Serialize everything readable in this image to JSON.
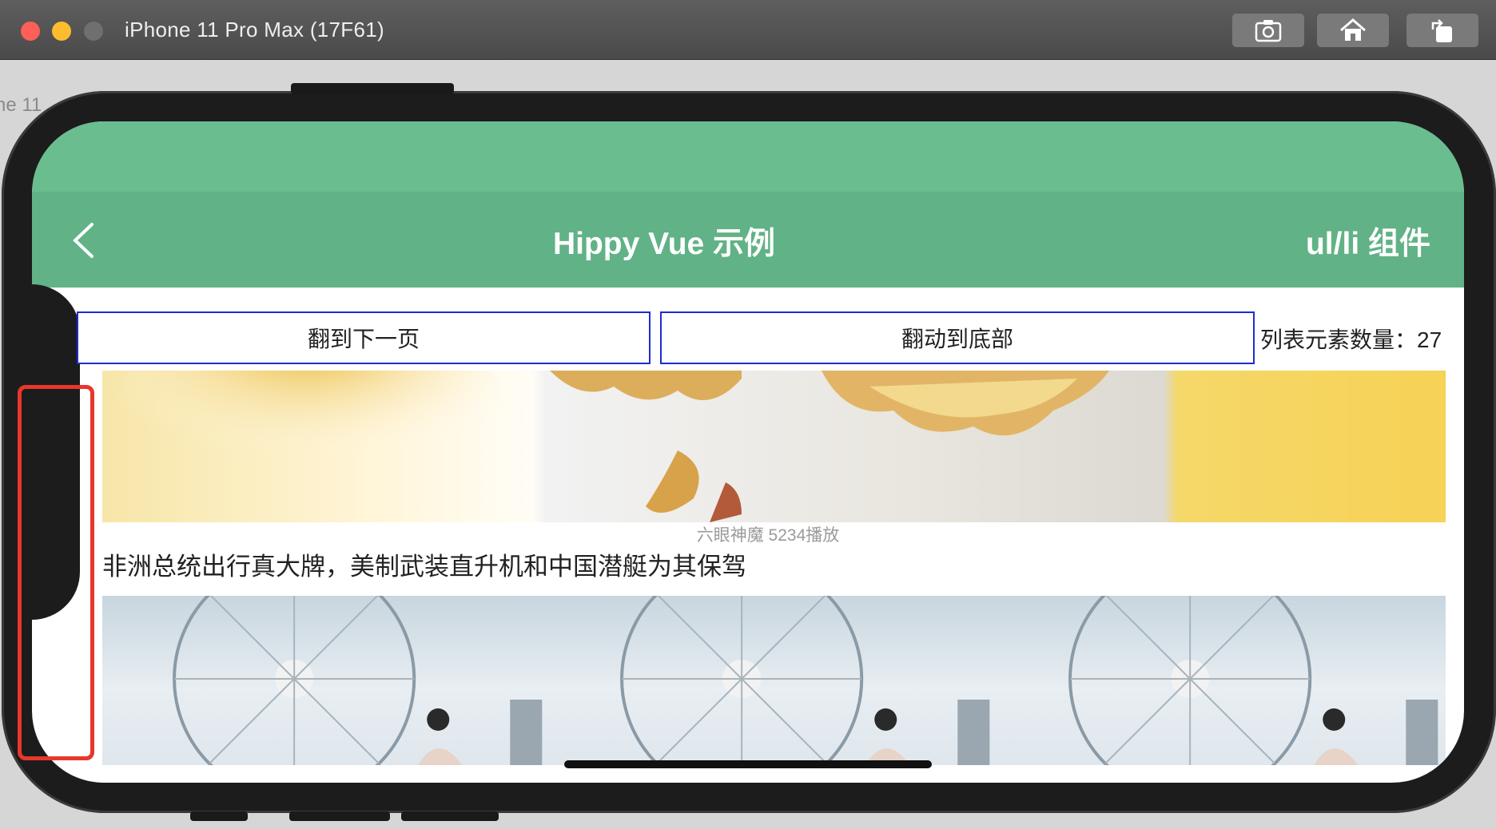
{
  "window": {
    "title": "iPhone 11 Pro Max (17F61)",
    "background_label": "ne 11",
    "toolbar_icons": [
      "screenshot-icon",
      "home-icon",
      "rotate-icon"
    ]
  },
  "navbar": {
    "title": "Hippy Vue 示例",
    "right_label": "ul/li 组件",
    "back_icon": "chevron-left-icon"
  },
  "controls": {
    "next_page_label": "翻到下一页",
    "scroll_bottom_label": "翻动到底部",
    "count_label": "列表元素数量：27"
  },
  "list": {
    "item1": {
      "caption": "六眼神魔  5234播放",
      "headline": "非洲总统出行真大牌，美制武装直升机和中国潜艇为其保驾"
    }
  },
  "colors": {
    "nav_green": "#61b286",
    "status_green": "#6abd8f",
    "button_border": "#1f2bd1",
    "highlight_red": "#e8372c"
  }
}
